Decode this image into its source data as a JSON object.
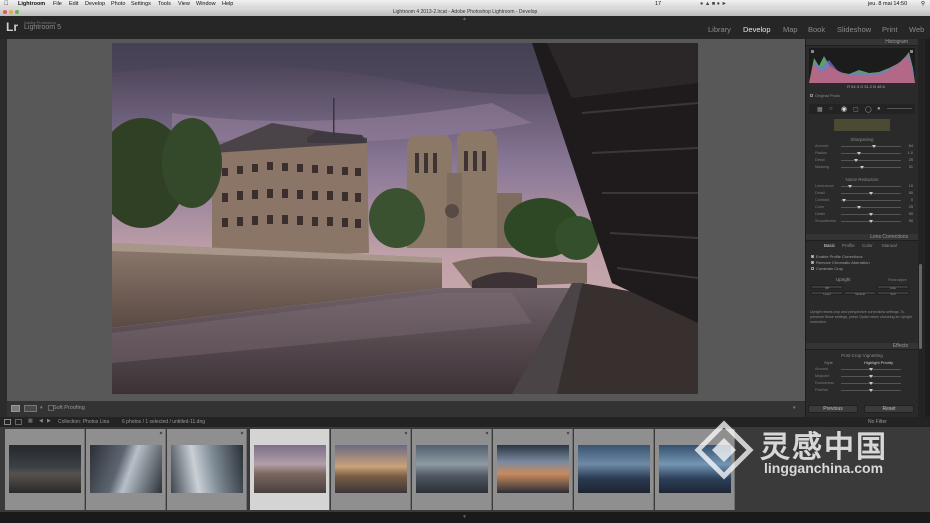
{
  "menubar": {
    "app": "Lightroom",
    "items": [
      "File",
      "Edit",
      "Develop",
      "Photo",
      "Settings",
      "Tools",
      "View",
      "Window",
      "Help"
    ],
    "battery_text": "17",
    "clock": "jeu. 8 mai 14:50"
  },
  "titlebar": {
    "title": "Lightroom 4 2013-2.lrcat - Adobe Photoshop Lightroom - Develop"
  },
  "identity": {
    "logo": "Lr",
    "line1": "Adobe Photoshop",
    "line2": "Lightroom 5"
  },
  "modules": [
    "Library",
    "Develop",
    "Map",
    "Book",
    "Slideshow",
    "Print",
    "Web"
  ],
  "active_module": "Develop",
  "toolbar": {
    "soft_proofing": "Soft Proofing"
  },
  "histogram": {
    "title": "Histogram",
    "readout": [
      "R 54.3",
      "G 51.2",
      "B 48.6"
    ],
    "original_photo": "Original Photo"
  },
  "detail": {
    "sharpening_label": "Sharpening",
    "sharpening": [
      {
        "label": "Amount",
        "value": "64",
        "pos": 0.55
      },
      {
        "label": "Radius",
        "value": "1.0",
        "pos": 0.3
      },
      {
        "label": "Detail",
        "value": "25",
        "pos": 0.25
      },
      {
        "label": "Masking",
        "value": "31",
        "pos": 0.35
      }
    ],
    "noise_label": "Noise Reduction",
    "noise": [
      {
        "label": "Luminance",
        "value": "10",
        "pos": 0.15
      },
      {
        "label": "Detail",
        "value": "50",
        "pos": 0.5
      },
      {
        "label": "Contrast",
        "value": "0",
        "pos": 0.05
      },
      {
        "label": "Color",
        "value": "25",
        "pos": 0.3
      },
      {
        "label": "Detail",
        "value": "50",
        "pos": 0.5
      },
      {
        "label": "Smoothness",
        "value": "50",
        "pos": 0.5
      }
    ]
  },
  "lens": {
    "title": "Lens Corrections",
    "tabs": [
      "Basic",
      "Profile",
      "Color",
      "Manual"
    ],
    "checks": [
      "Enable Profile Corrections",
      "Remove Chromatic Aberration",
      "Constrain Crop"
    ],
    "upright_label": "Upright",
    "upright_reanalyze": "Reanalyze",
    "upright_buttons": [
      "Off",
      "Auto",
      "Level",
      "Vertical",
      "Full"
    ],
    "upright_note": "Upright resets crop and perspective corrections settings. To preserve those settings, press Option when choosing an Upright correction."
  },
  "effects": {
    "title": "Effects",
    "vignette_label": "Post-Crop Vignetting",
    "style_label": "Style",
    "style_value": "Highlight Priority",
    "sliders": [
      {
        "label": "Amount",
        "value": "",
        "pos": 0.5
      },
      {
        "label": "Midpoint",
        "value": "",
        "pos": 0.5
      },
      {
        "label": "Roundness",
        "value": "",
        "pos": 0.5
      },
      {
        "label": "Feather",
        "value": "",
        "pos": 0.5
      }
    ]
  },
  "buttons": {
    "previous": "Previous",
    "reset": "Reset"
  },
  "filmstrip_bar": {
    "collection": "Collection: Photos Lina",
    "count": "6 photos / 1 selected / untitled-11.dng",
    "filter": "No Filter"
  },
  "filmstrip": {
    "count": 9,
    "selected_index": 3
  },
  "watermark": {
    "brand": "灵感中国",
    "url": "lingganchina.com"
  }
}
